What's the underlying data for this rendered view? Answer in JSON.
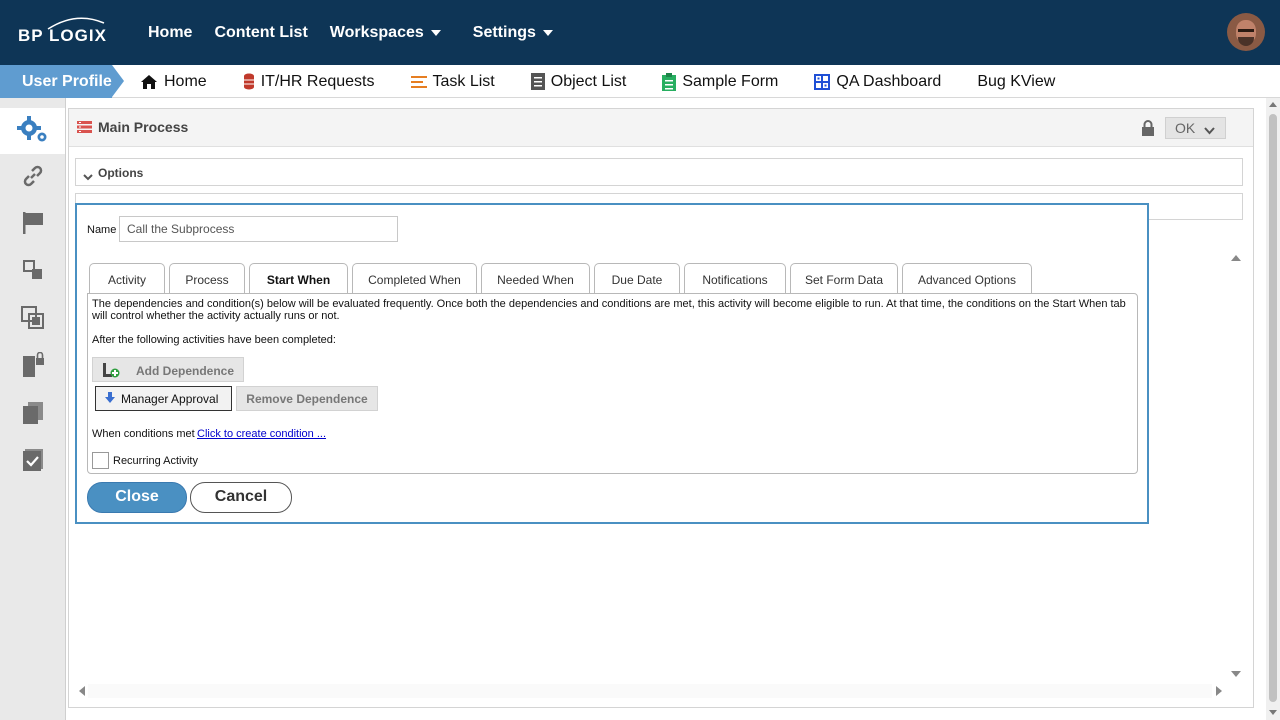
{
  "brand": {
    "logo_text": "BP LOGIX"
  },
  "topnav": {
    "items": [
      "Home",
      "Content List",
      "Workspaces",
      "Settings"
    ]
  },
  "secnav": {
    "profile_label": "User Profile",
    "items": [
      "Home",
      "IT/HR Requests",
      "Task List",
      "Object List",
      "Sample Form",
      "QA Dashboard",
      "Bug KView"
    ]
  },
  "left_rail": {
    "icons": [
      "gears-icon",
      "link-icon",
      "flag-icon",
      "subprocess-icon",
      "copy-icon",
      "locked-doc-icon",
      "pages-icon",
      "checklist-icon"
    ]
  },
  "process": {
    "title": "Main Process",
    "ok_label": "OK",
    "options_label": "Options"
  },
  "dialog": {
    "name_label": "Name",
    "name_value": "Call the Subprocess",
    "tabs": [
      "Activity",
      "Process",
      "Start When",
      "Completed When",
      "Needed When",
      "Due Date",
      "Notifications",
      "Set Form Data",
      "Advanced Options"
    ],
    "active_tab": "Start When",
    "description": "The dependencies and condition(s) below will be evaluated frequently. Once both the dependencies and conditions are met, this activity will become eligible to run. At that time, the conditions on the Start When tab will control whether the activity actually runs or not.",
    "after_label": "After the following activities have been completed:",
    "add_dependence": "Add Dependence",
    "dependency_item": "Manager Approval",
    "remove_dependence": "Remove Dependence",
    "conditions_label": "When conditions met",
    "conditions_link": "Click to create condition ...",
    "recurring_label": "Recurring Activity",
    "close_label": "Close",
    "cancel_label": "Cancel"
  },
  "colors": {
    "topbar": "#0e3556",
    "accent": "#4a90c2",
    "profile_tab": "#5f9cd0"
  }
}
